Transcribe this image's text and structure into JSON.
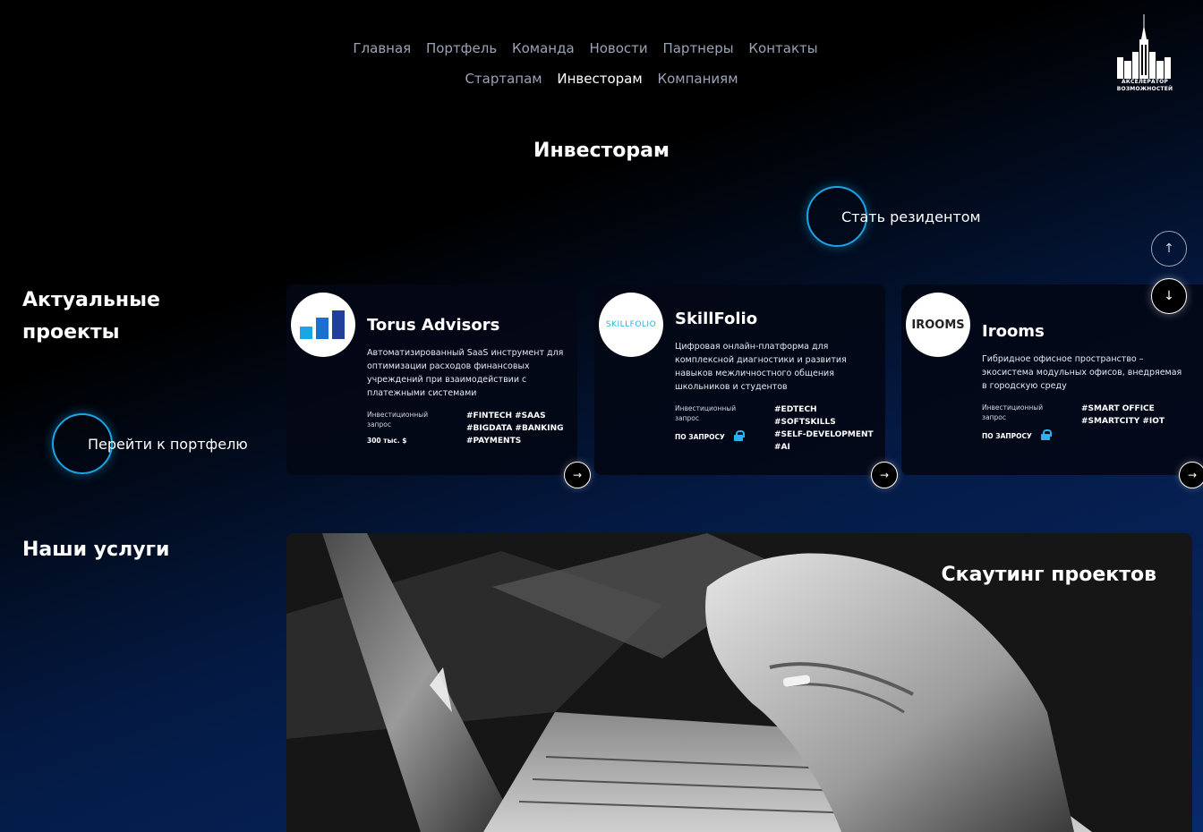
{
  "nav": {
    "row1": [
      "Главная",
      "Портфель",
      "Команда",
      "Новости",
      "Партнеры",
      "Контакты"
    ],
    "row2": [
      "Стартапам",
      "Инвесторам",
      "Компаниям"
    ],
    "active": "Инвесторам"
  },
  "logo": {
    "line1": "АКСЕЛЕРАТОР",
    "line2": "ВОЗМОЖНОСТЕЙ",
    "icon": "university-building-icon"
  },
  "page_title": "Инвесторам",
  "cta_resident": "Стать резидентом",
  "scroll": {
    "up_icon": "arrow-up-icon",
    "down_icon": "arrow-down-icon"
  },
  "projects": {
    "title_line1": "Актуальные",
    "title_line2": "проекты",
    "portfolio_link": "Перейти к портфелю",
    "cards": [
      {
        "name": "Torus Advisors",
        "desc": "Автоматизированный SaaS инструмент для оптимизации расходов финансовых учреждений при взаимодействии с платежными системами",
        "label": "Инвестиционный запрос",
        "amount": "300 тыс. $",
        "tags": [
          "#FINTECH  #SAAS",
          "#BIGDATA  #BANKING",
          "#PAYMENTS"
        ]
      },
      {
        "name": "SkillFolio",
        "logo_text": "SKILLFOLIO",
        "desc": "Цифровая онлайн-платформа для комплексной диагностики и развития навыков межличностного общения школьников и студентов",
        "label": "Инвестиционный запрос",
        "amount": "по запросу",
        "tags": [
          "#EDTECH",
          "#SOFTSKILLS",
          "#SELF-DEVELOPMENT",
          "#AI"
        ]
      },
      {
        "name": "Irooms",
        "logo_text": "IROOMS",
        "desc": "Гибридное офисное пространство – экосистема модульных офисов, внедряемая в городскую среду",
        "label": "Инвестиционный запрос",
        "amount": "по запросу",
        "tags": [
          "#SMART OFFICE",
          "#SMARTCITY  #IOT"
        ]
      }
    ]
  },
  "services": {
    "title": "Наши услуги",
    "card_title": "Скаутинг проектов"
  },
  "colors": {
    "accent_ring": "#1aa6e6",
    "lock": "#2bb3f0",
    "bar_light": "#1aa6e6",
    "bar_dark": "#1f3f9a"
  }
}
